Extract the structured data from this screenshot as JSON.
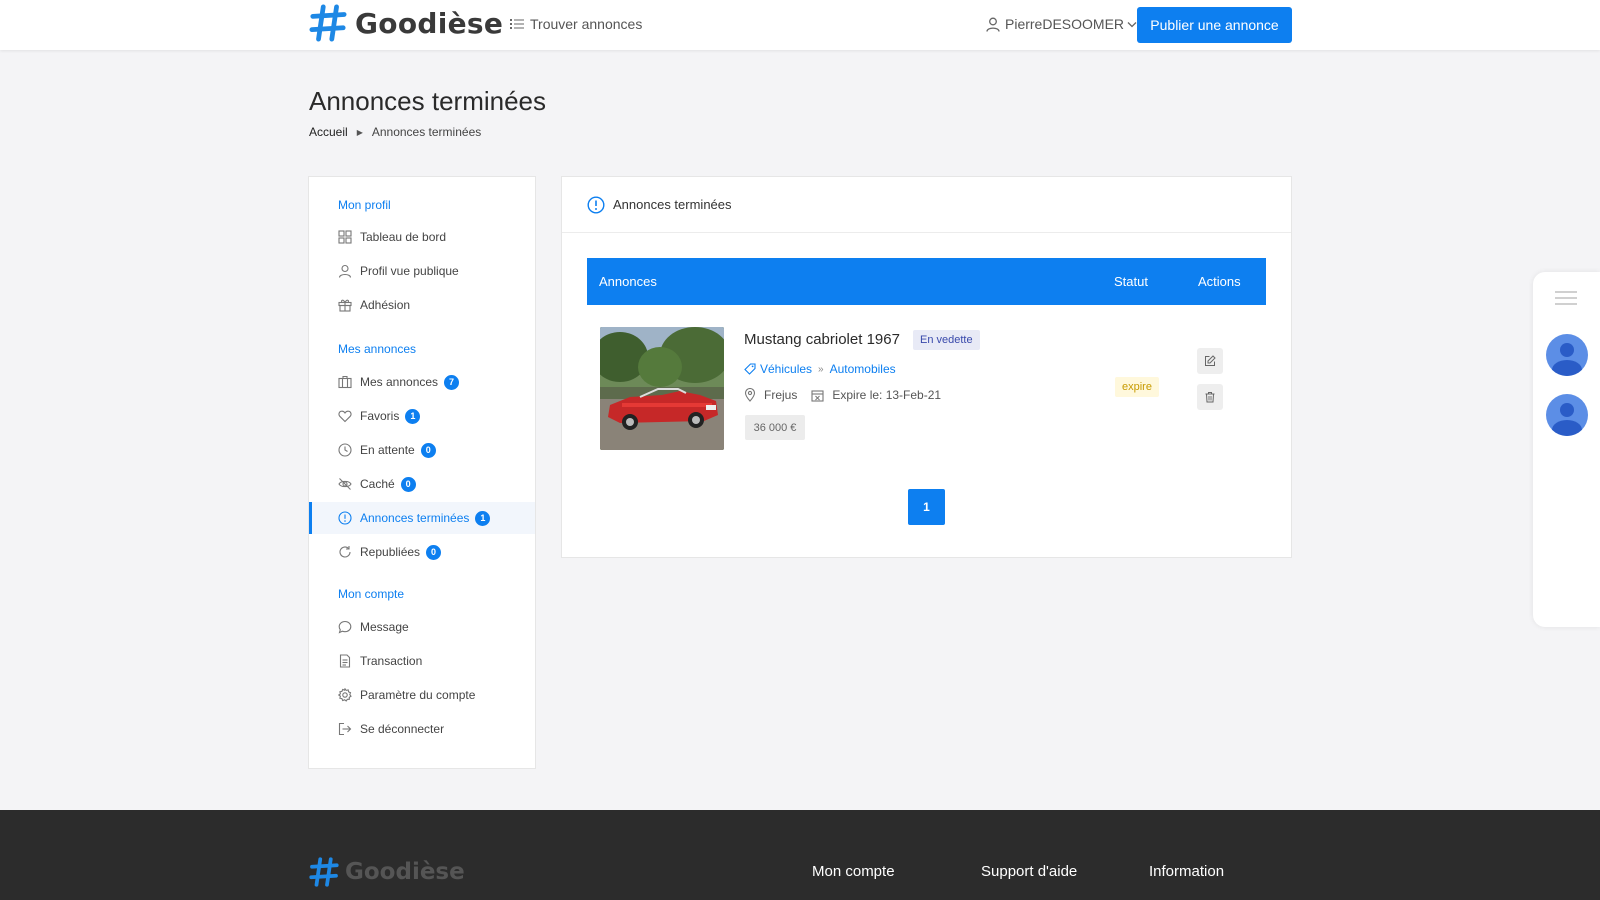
{
  "header": {
    "logo_text": "Goodièse",
    "find_ads_label": "Trouver annonces",
    "username": "PierreDESOOMER",
    "publish_label": "Publier une annonce"
  },
  "page": {
    "title": "Annonces terminées",
    "breadcrumb": {
      "home": "Accueil",
      "current": "Annonces terminées"
    }
  },
  "sidebar": {
    "sections": [
      {
        "heading": "Mon profil"
      },
      {
        "heading": "Mes annonces"
      },
      {
        "heading": "Mon compte"
      }
    ],
    "items": [
      {
        "label": "Tableau de bord",
        "icon": "grid-icon"
      },
      {
        "label": "Profil vue publique",
        "icon": "user-icon"
      },
      {
        "label": "Adhésion",
        "icon": "gift-icon"
      },
      {
        "label": "Mes annonces",
        "icon": "briefcase-icon",
        "badge": "7"
      },
      {
        "label": "Favoris",
        "icon": "heart-icon",
        "badge": "1"
      },
      {
        "label": "En attente",
        "icon": "clock-icon",
        "badge": "0"
      },
      {
        "label": "Caché",
        "icon": "eye-off-icon",
        "badge": "0"
      },
      {
        "label": "Annonces terminées",
        "icon": "alert-circle-icon",
        "badge": "1",
        "active": true
      },
      {
        "label": "Republiées",
        "icon": "refresh-icon",
        "badge": "0"
      },
      {
        "label": "Message",
        "icon": "message-icon"
      },
      {
        "label": "Transaction",
        "icon": "document-icon"
      },
      {
        "label": "Paramètre du compte",
        "icon": "settings-icon"
      },
      {
        "label": "Se déconnecter",
        "icon": "logout-icon"
      }
    ]
  },
  "main": {
    "card_title": "Annonces terminées",
    "table_headers": {
      "ads": "Annonces",
      "status": "Statut",
      "actions": "Actions"
    },
    "listing": {
      "title": "Mustang cabriolet 1967",
      "featured_label": "En vedette",
      "category": "Véhicules",
      "subcategory": "Automobiles",
      "location": "Frejus",
      "expiry": "Expire le: 13-Feb-21",
      "price": "36 000 €",
      "status": "expire"
    },
    "pagination": [
      "1"
    ]
  },
  "footer": {
    "logo_text": "Goodièse",
    "columns": [
      "Mon compte",
      "Support d'aide",
      "Information"
    ]
  },
  "colors": {
    "accent": "#0d7ff0",
    "footer_bg": "#2c2c2c",
    "status_bg": "#fff8dc",
    "status_text": "#c79a00"
  }
}
